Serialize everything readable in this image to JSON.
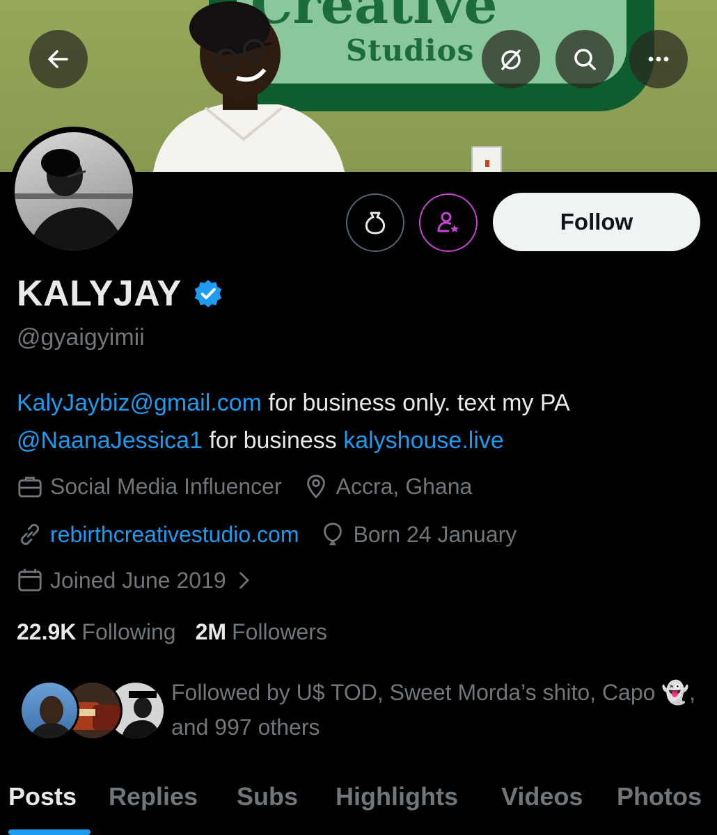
{
  "header": {
    "back_icon": "arrow-left-icon",
    "grok_icon": "grok-icon",
    "search_icon": "search-icon",
    "more_icon": "more-icon",
    "banner_sign_text": "Studios",
    "banner_sign_big": "Creative"
  },
  "actions": {
    "coin_icon": "money-bag-icon",
    "subscribe_icon": "subscribe-person-star-icon",
    "follow_label": "Follow"
  },
  "profile": {
    "display_name": "KALYJAY",
    "verified_icon": "verified-badge-icon",
    "handle": "@gyaigyimii",
    "bio": {
      "email": "KalyJaybiz@gmail.com",
      "text1": " for business only. text my PA ",
      "mention": "@NaanaJessica1",
      "text2": " for business ",
      "site": "kalyshouse.live"
    },
    "profession": "Social Media Influencer",
    "location": "Accra, Ghana",
    "website": "rebirthcreativestudio.com",
    "birthday": "Born 24 January",
    "joined": "Joined June 2019"
  },
  "stats": {
    "following_count": "22.9K",
    "following_label": "Following",
    "followers_count": "2M",
    "followers_label": "Followers"
  },
  "followed_by": {
    "line1": "Followed by U$ TOD, Sweet Morda’s shito, Capo",
    "emoji": "👻",
    "line2": ", and 997 others"
  },
  "tabs": [
    "Posts",
    "Replies",
    "Subs",
    "Highlights",
    "Videos",
    "Photos"
  ],
  "colors": {
    "accent": "#1d9bf0",
    "subscribe_ring": "#c944d4",
    "muted": "#71767b"
  }
}
